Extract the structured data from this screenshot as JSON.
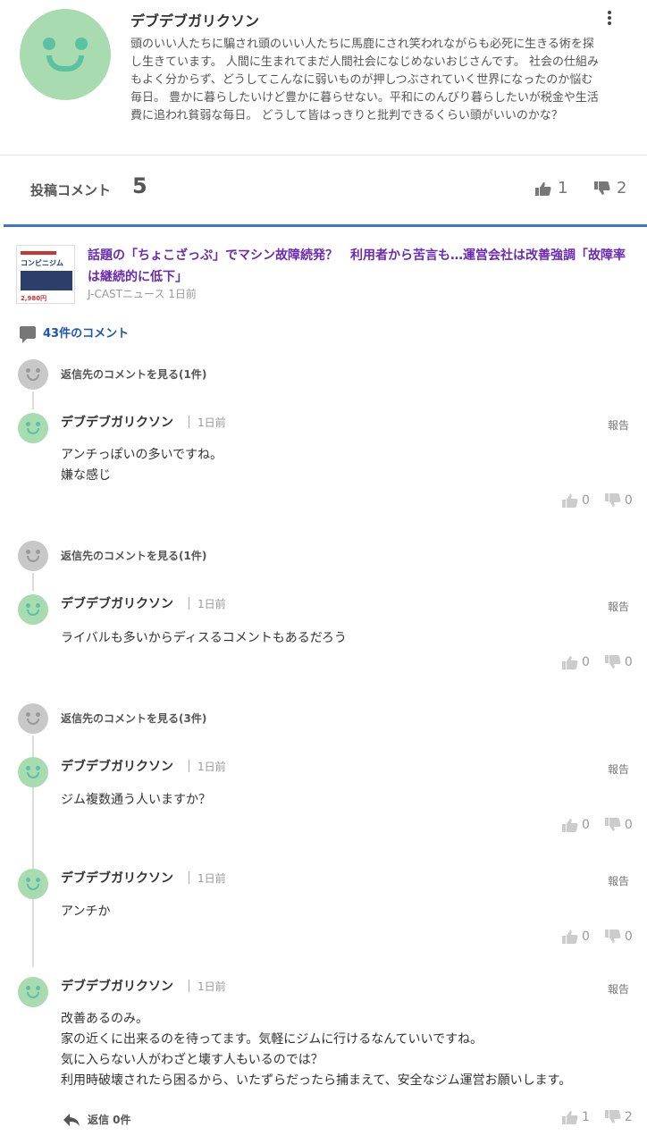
{
  "profile": {
    "name": "デブデブガリクソン",
    "bio": "頭のいい人たちに騙され頭のいい人たちに馬鹿にされ笑われながらも必死に生きる術を探し生きています。 人間に生まれてまだ人間社会になじめないおじさんです。 社会の仕組みもよく分からず、どうしてこんなに弱いものが押しつぶされていく世界になったのか悩む毎日。 豊かに暮らしたいけど豊かに暮らせない。平和にのんびり暮らしたいが税金や生活費に追われ貧弱な毎日。 どうして皆はっきりと批判できるくらい頭がいいのかな？"
  },
  "stats": {
    "label": "投稿コメント",
    "count": "5",
    "likes": "1",
    "dislikes": "2"
  },
  "article": {
    "title": "話題の「ちょこざっぷ」でマシン故障続発？　利用者から苦言も…運営会社は改善強調「故障率は継続的に低下」",
    "source": "J-CASTニュース 1日前",
    "thumb_text": "コンビニジム",
    "thumb_price": "2,980円"
  },
  "comment_count": "43件のコメント",
  "threads": [
    {
      "reply_link": "返信先のコメントを見る(1件)",
      "comments": [
        {
          "name": "デブデブガリクソン",
          "time": "1日前",
          "report": "報告",
          "body": "アンチっぽいの多いですね。\n嫌な感じ",
          "likes": "0",
          "dislikes": "0"
        }
      ]
    },
    {
      "reply_link": "返信先のコメントを見る(1件)",
      "comments": [
        {
          "name": "デブデブガリクソン",
          "time": "1日前",
          "report": "報告",
          "body": "ライバルも多いからディスるコメントもあるだろう",
          "likes": "0",
          "dislikes": "0"
        }
      ]
    },
    {
      "reply_link": "返信先のコメントを見る(3件)",
      "comments": [
        {
          "name": "デブデブガリクソン",
          "time": "1日前",
          "report": "報告",
          "body": "ジム複数通う人いますか？",
          "likes": "0",
          "dislikes": "0"
        },
        {
          "name": "デブデブガリクソン",
          "time": "1日前",
          "report": "報告",
          "body": "アンチか",
          "likes": "0",
          "dislikes": "0"
        },
        {
          "name": "デブデブガリクソン",
          "time": "1日前",
          "report": "報告",
          "body": "改善あるのみ。\n家の近くに出来るのを待ってます。気軽にジムに行けるなんていいですね。\n気に入らない人がわざと壊す人もいるのでは？\n利用時破壊されたら困るから、いたずらだったら捕まえて、安全なジム運営お願いします。",
          "likes": "1",
          "dislikes": "2"
        }
      ]
    }
  ],
  "reply_button": "返信 0件",
  "colors": {
    "accent_blue": "#3d78c8",
    "title_purple": "#6a2bb0",
    "link_blue": "#1c55b4",
    "avatar_green": "#a8dbb0"
  }
}
